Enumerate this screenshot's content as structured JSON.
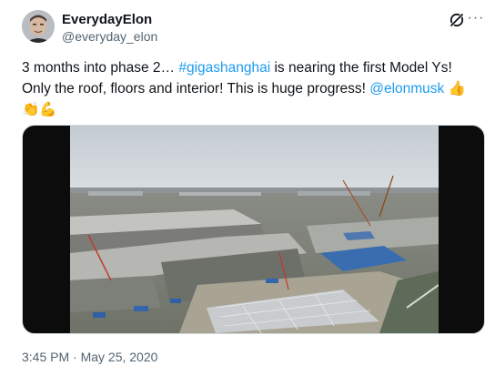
{
  "author": {
    "display_name": "EverydayElon",
    "handle": "@everyday_elon"
  },
  "header_icons": [
    "grok-icon",
    "more-icon"
  ],
  "more_label": "···",
  "tweet": {
    "text_part1": "3 months into phase 2… ",
    "hashtag": "#gigashanghai",
    "text_part2": " is nearing the first Model Ys!",
    "text_line2": "Only the roof, floors and interior! This is huge progress! ",
    "mention": "@elonmusk",
    "emoji_line2": " 👍",
    "emoji_line3": "👏💪"
  },
  "media": {
    "type": "video",
    "description_icon": "video-frame"
  },
  "timestamp": "3:45 PM · May 25, 2020",
  "colors": {
    "link": "#1d9bf0",
    "secondary_text": "#536471",
    "primary_text": "#0f1419"
  }
}
